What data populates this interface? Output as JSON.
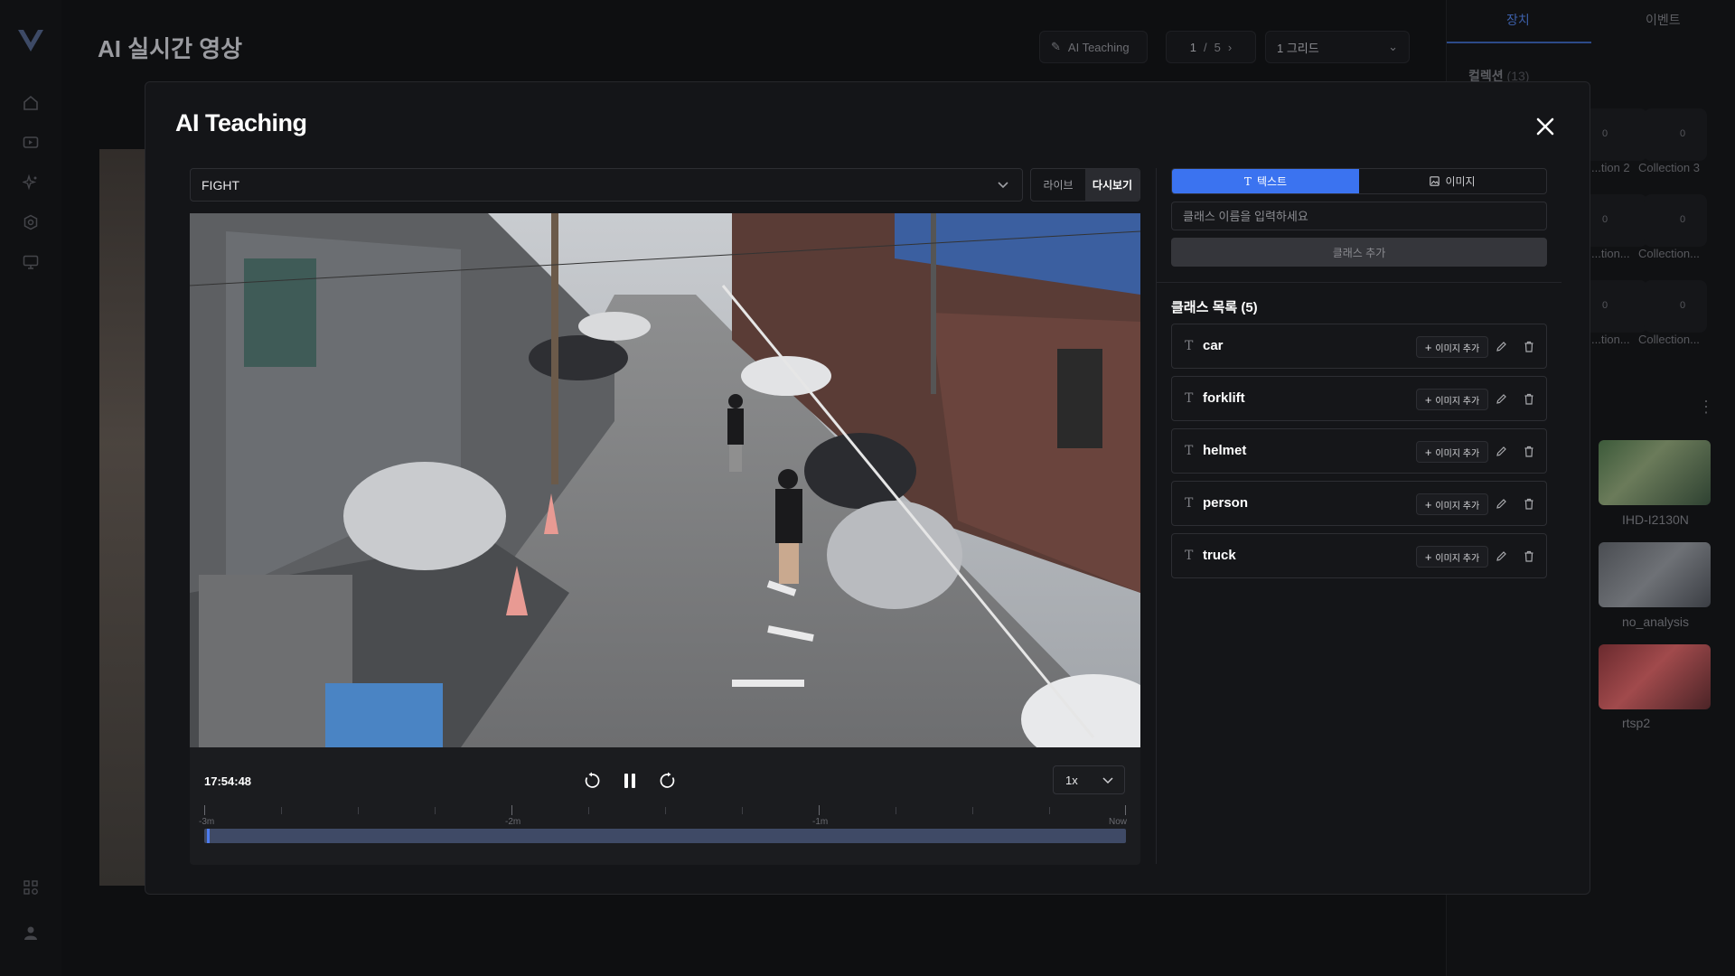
{
  "background": {
    "page_title": "AI 실시간 영상",
    "toolbar": {
      "ai_teaching": "AI Teaching",
      "page_current": "1",
      "page_sep": "/",
      "page_total": "5",
      "grid_select": "1 그리드"
    },
    "right_panel": {
      "tabs": [
        "장치",
        "이벤트"
      ],
      "collection_title": "컬렉션",
      "collection_count": "(13)",
      "collections": [
        {
          "label": "...tion 2",
          "count": "0"
        },
        {
          "label": "Collection 3",
          "count": "0"
        },
        {
          "label": "...tion...",
          "count": "0"
        },
        {
          "label": "Collection...",
          "count": "0"
        },
        {
          "label": "...tion...",
          "count": "0"
        },
        {
          "label": "Collection...",
          "count": "0"
        }
      ],
      "cameras": [
        "IHD-I2130N",
        "no_analysis",
        "rtsp2"
      ]
    }
  },
  "modal": {
    "title": "AI Teaching",
    "event_select": "FIGHT",
    "mode": {
      "live": "라이브",
      "replay": "다시보기",
      "active": "replay"
    },
    "player": {
      "time": "17:54:48",
      "speed": "1x",
      "timeline_labels": [
        "-3m",
        "-2m",
        "-1m",
        "Now"
      ],
      "progress": 0.003
    },
    "panel": {
      "tab_text": "텍스트",
      "tab_image": "이미지",
      "input_placeholder": "클래스 이름을 입력하세요",
      "add_button": "클래스 추가",
      "list_title": "클래스 목록 (5)",
      "add_image_label": "이미지 추가",
      "classes": [
        "car",
        "forklift",
        "helmet",
        "person",
        "truck"
      ]
    }
  },
  "colors": {
    "accent": "#3b73f0",
    "modal_bg": "#141518",
    "page_bg": "#0e0f11"
  }
}
